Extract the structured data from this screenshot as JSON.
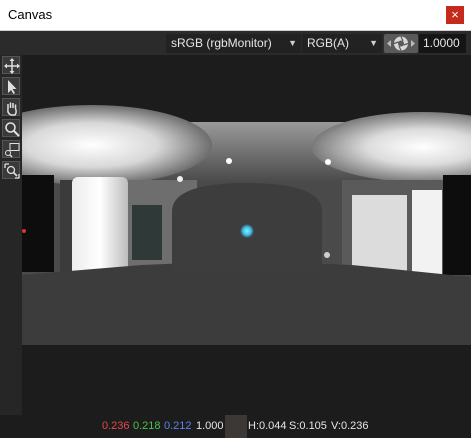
{
  "window": {
    "title": "Canvas",
    "close_glyph": "×"
  },
  "toolbar": {
    "colorspace": "sRGB (rgbMonitor)",
    "channels": "RGB(A)",
    "exposure": "1.0000"
  },
  "tools": [
    "move-tool",
    "select-tool",
    "pan-tool",
    "zoom-tool",
    "region-tool",
    "zoom-region-tool"
  ],
  "status": {
    "r": "0.236",
    "g": "0.218",
    "b": "0.212",
    "a": "1.000",
    "h": "H:0.044",
    "s": "S:0.105",
    "v": "V:0.236",
    "swatch_color": "#3c3836"
  }
}
